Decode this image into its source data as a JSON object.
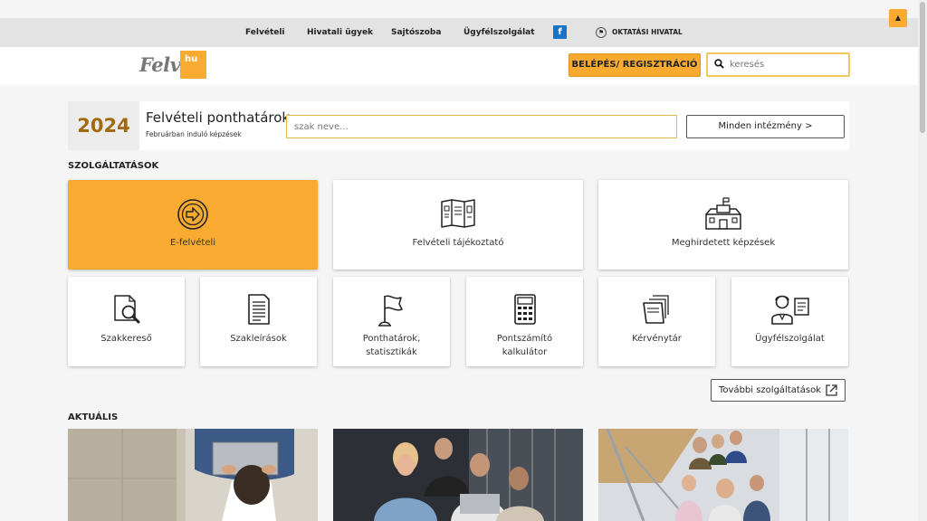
{
  "topnav": {
    "items": [
      "Felvételi",
      "Hivatali ügyek",
      "Sajtószoba",
      "Ügyfélszolgálat"
    ],
    "facebook_glyph": "f",
    "oktatasi_hivatal": "OKTATÁSI HIVATAL"
  },
  "header": {
    "logo_text": "Felvi",
    "logo_suffix": "hu",
    "login_label": "BELÉPÉS/ REGISZTRÁCIÓ",
    "search_placeholder": "keresés"
  },
  "ponthatarok": {
    "year": "2024",
    "title": "Felvételi ponthatárok",
    "subtitle": "Februárban induló képzések",
    "input_placeholder": "szak neve...",
    "button_label": "Minden intézmény >"
  },
  "services": {
    "title": "SZOLGÁLTATÁSOK",
    "big": [
      {
        "label": "E-felvételi",
        "icon": "arrow-circle-icon"
      },
      {
        "label": "Felvételi tájékoztató",
        "icon": "map-brochure-icon"
      },
      {
        "label": "Meghirdetett képzések",
        "icon": "university-building-icon"
      }
    ],
    "small": [
      {
        "label": "Szakkereső",
        "icon": "document-search-icon"
      },
      {
        "label": "Szakleírások",
        "icon": "document-list-icon"
      },
      {
        "label": "Ponthatárok,\nstatisztikák",
        "icon": "flag-icon"
      },
      {
        "label": "Pontszámító\nkalkulátor",
        "icon": "calculator-icon"
      },
      {
        "label": "Kérvénytár",
        "icon": "folder-documents-icon"
      },
      {
        "label": "Ügyfélszolgálat",
        "icon": "customer-service-icon"
      }
    ],
    "more_label": "További szolgáltatások"
  },
  "news": {
    "title": "AKTUÁLIS"
  },
  "colors": {
    "accent": "#f9ab31",
    "topnav_bg": "#e3e3e3",
    "year_text": "#a16a10"
  }
}
